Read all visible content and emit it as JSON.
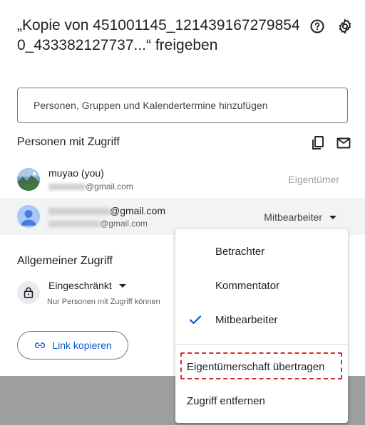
{
  "dialog": {
    "title": "„Kopie von 451001145_1214391672798540_433382127737...“ freigeben",
    "help_icon": "help-circle-icon",
    "settings_icon": "gear-icon"
  },
  "search": {
    "placeholder": "Personen, Gruppen und Kalendertermine hinzufügen",
    "value": ""
  },
  "people_section": {
    "title": "Personen mit Zugriff",
    "copy_icon": "copy-icon",
    "mail_icon": "mail-icon",
    "people": [
      {
        "name": "muyao (you)",
        "email_suffix": "@gmail.com",
        "role": "Eigentümer"
      },
      {
        "name_suffix": "@gmail.com",
        "email_suffix": "@gmail.com",
        "role": "Mitbearbeiter"
      }
    ]
  },
  "general_access": {
    "title": "Allgemeiner Zugriff",
    "level": "Eingeschränkt",
    "description": "Nur Personen mit Zugriff können",
    "lock_icon": "lock-icon"
  },
  "link_button": {
    "label": "Link kopieren",
    "icon": "link-icon"
  },
  "role_menu": {
    "items": [
      {
        "label": "Betrachter",
        "checked": false
      },
      {
        "label": "Kommentator",
        "checked": false
      },
      {
        "label": "Mitbearbeiter",
        "checked": true
      }
    ],
    "transfer_label": "Eigentümerschaft übertragen",
    "remove_label": "Zugriff entfernen",
    "highlight_color": "#d32f2f"
  }
}
